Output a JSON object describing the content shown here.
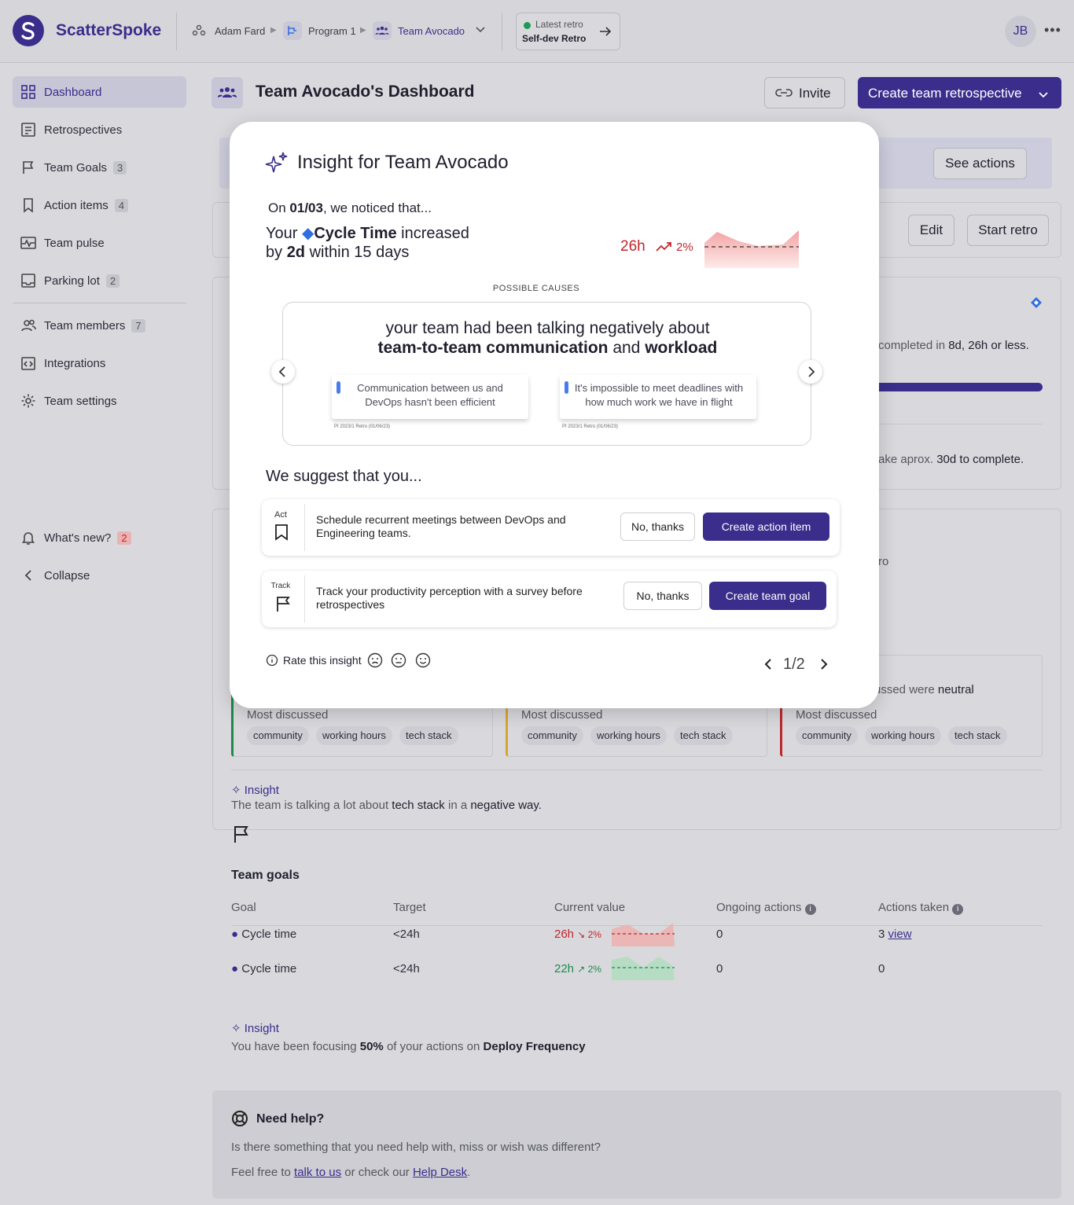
{
  "brand": {
    "name": "ScatterSpoke"
  },
  "breadcrumb": {
    "user": "Adam Fard",
    "program": "Program 1",
    "team": "Team Avocado"
  },
  "latest_retro": {
    "label": "Latest retro",
    "name": "Self-dev Retro"
  },
  "avatar": {
    "initials": "JB"
  },
  "sidebar": {
    "items": [
      {
        "label": "Dashboard"
      },
      {
        "label": "Retrospectives"
      },
      {
        "label": "Team Goals",
        "count": "3"
      },
      {
        "label": "Action items",
        "count": "4"
      },
      {
        "label": "Team pulse"
      },
      {
        "label": "Parking lot",
        "count": "2"
      },
      {
        "label": "Team members",
        "count": "7"
      },
      {
        "label": "Integrations"
      },
      {
        "label": "Team settings"
      }
    ],
    "whats_new": "What's new?",
    "whats_new_count": "2",
    "collapse": "Collapse"
  },
  "header": {
    "title": "Team Avocado's Dashboard",
    "invite": "Invite",
    "create": "Create team retrospective"
  },
  "background": {
    "see_actions": "See actions",
    "edit": "Edit",
    "start_retro": "Start retro",
    "completed_pre": "completed in ",
    "completed_val": "8d, 26h or less.",
    "aprox_pre": "ake aprox. ",
    "aprox_val": "30d to complete.",
    "ro_frag": "ro",
    "neutral_pre": "ussed were ",
    "neutral_val": "neutral",
    "most_discussed": "Most discussed",
    "chips": [
      "community",
      "working hours",
      "tech stack"
    ],
    "insight_label": "Insight",
    "insight1_a": "The team is talking a lot about ",
    "insight1_b": "tech stack",
    "insight1_c": " in a ",
    "insight1_d": "negative way.",
    "team_goals_title": "Team goals",
    "goal_headers": [
      "Goal",
      "Target",
      "Current value",
      "Ongoing actions",
      "Actions taken"
    ],
    "goals": [
      {
        "goal": "Cycle time",
        "target": "<24h",
        "current": "26h",
        "pct": "2%",
        "ongoing": "0",
        "taken": "3",
        "taken_link": "view"
      },
      {
        "goal": "Cycle time",
        "target": "<24h",
        "current": "22h",
        "pct": "2%",
        "ongoing": "0",
        "taken": "0"
      }
    ],
    "insight2_a": "You have been focusing ",
    "insight2_b": "50%",
    "insight2_c": " of your actions on ",
    "insight2_d": "Deploy Frequency",
    "help_title": "Need help?",
    "help_line1": "Is there something that you need help with, miss or wish was different?",
    "help_line2_a": "Feel free to ",
    "help_link1": "talk to us",
    "help_line2_b": " or check our ",
    "help_link2": "Help Desk",
    "help_line2_c": "."
  },
  "modal": {
    "title": "Insight for Team Avocado",
    "noticed_a": "On ",
    "noticed_date": "01/03",
    "noticed_b": ", we noticed that...",
    "metric_a": "Your ",
    "metric_name": "Cycle Time",
    "metric_b": " increased",
    "metric_c": "by ",
    "metric_d": "2d",
    "metric_e": " within 15 days",
    "metric_value": "26h",
    "metric_pct": "2%",
    "possible_causes": "POSSIBLE CAUSES",
    "cause_line1": "your team had been talking negatively about",
    "cause_topic1": "team-to-team communication",
    "cause_and": " and ",
    "cause_topic2": "workload",
    "sticky1": "Communication between us and DevOps hasn't been efficient",
    "sticky2": "It's impossible to meet deadlines with how much work we have in flight",
    "sticky_src": "PI 2023/1 Retro (01/06/23)",
    "suggest_title": "We suggest that you...",
    "act_label": "Act",
    "act_text": "Schedule recurrent meetings between DevOps and Engineering teams.",
    "track_label": "Track",
    "track_text": "Track your productivity perception with a survey before retrospectives",
    "no_thanks": "No, thanks",
    "create_action": "Create action item",
    "create_goal": "Create team goal",
    "rate": "Rate this insight",
    "pager": "1/2"
  },
  "colors": {
    "accent": "#3a2d8c",
    "negative": "#c0262d",
    "positive": "#1e8a4c",
    "amber": "#e3b23c"
  }
}
